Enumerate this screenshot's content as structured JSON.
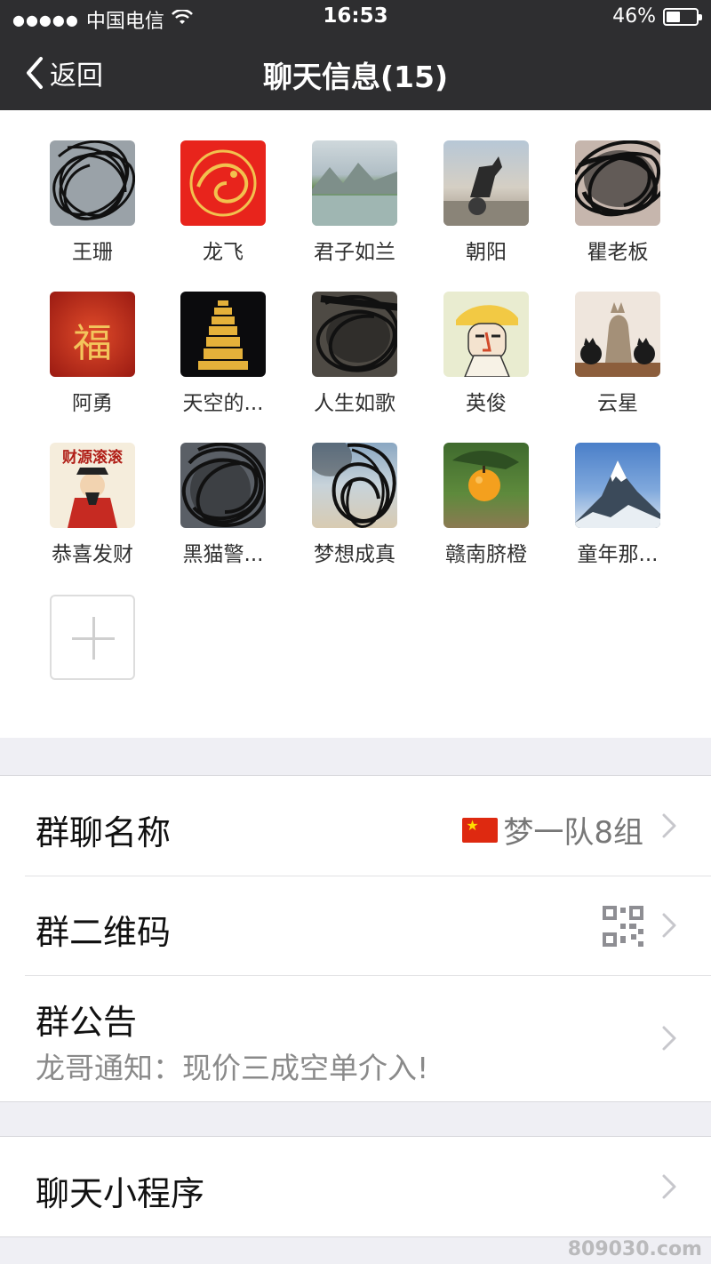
{
  "status_bar": {
    "carrier": "中国电信",
    "time": "16:53",
    "battery": "46%",
    "battery_level": 0.46
  },
  "nav": {
    "back_label": "返回",
    "title": "聊天信息(15)"
  },
  "members": [
    {
      "name": "王珊",
      "avatar": "scribbled"
    },
    {
      "name": "龙飞",
      "avatar": "dragon"
    },
    {
      "name": "君子如兰",
      "avatar": "landscape"
    },
    {
      "name": "朝阳",
      "avatar": "statue"
    },
    {
      "name": "瞿老板",
      "avatar": "scribbled"
    },
    {
      "name": "阿勇",
      "avatar": "fu"
    },
    {
      "name": "天空的...",
      "avatar": "pagoda"
    },
    {
      "name": "人生如歌",
      "avatar": "scribbled"
    },
    {
      "name": "英俊",
      "avatar": "cartoon"
    },
    {
      "name": "云星",
      "avatar": "cats"
    },
    {
      "name": "恭喜发财",
      "avatar": "caishen"
    },
    {
      "name": "黑猫警...",
      "avatar": "scribbled"
    },
    {
      "name": "梦想成真",
      "avatar": "scribbled-beach"
    },
    {
      "name": "赣南脐橙",
      "avatar": "orange"
    },
    {
      "name": "童年那...",
      "avatar": "mountain"
    }
  ],
  "avatar_texts": {
    "fu": "福",
    "caishen": "财源滚滚"
  },
  "settings": {
    "group_name_label": "群聊名称",
    "group_name_value": "梦一队8组",
    "qr_label": "群二维码",
    "notice_label": "群公告",
    "notice_text": "龙哥通知：现价三成空单介入!",
    "mini_program_label": "聊天小程序"
  },
  "watermark": "809030.com",
  "icons": [
    "chevron-left-icon",
    "wifi-icon",
    "battery-icon",
    "add-member-icon",
    "china-flag-icon",
    "qr-code-icon",
    "chevron-right-icon"
  ],
  "colors": {
    "nav_bg": "#2e2e30",
    "page_bg": "#efeff4",
    "text_secondary": "#8a8a8a"
  }
}
